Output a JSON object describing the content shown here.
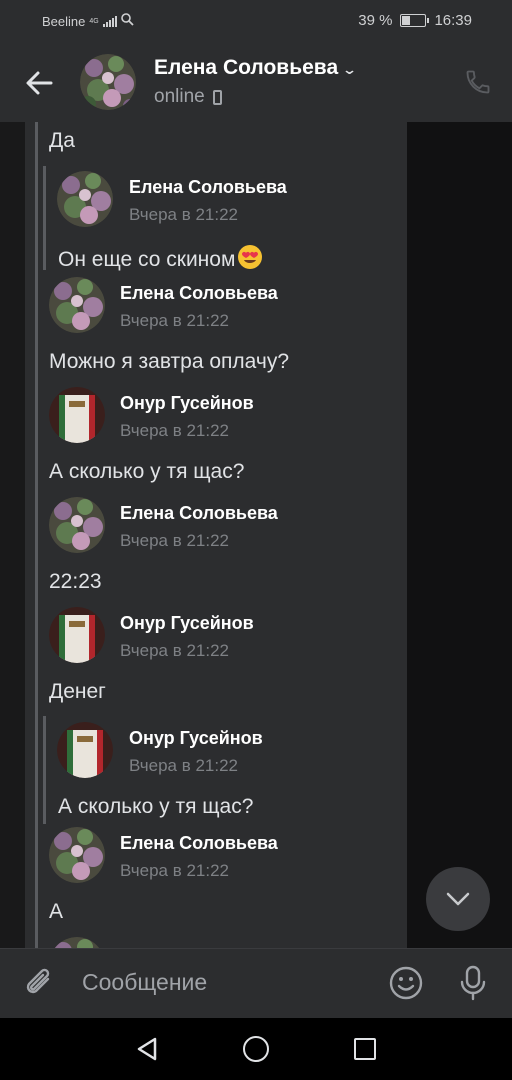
{
  "status_bar": {
    "carrier": "Beeline",
    "network": "4G",
    "battery": "39 %",
    "battery_level": 0.39,
    "time": "16:39"
  },
  "header": {
    "name": "Елена Соловьева",
    "status": "online",
    "icons": {
      "back": "arrow-left-icon",
      "expand": "chevron-down-icon",
      "device": "mobile-phone-icon",
      "call": "phone-call-icon"
    }
  },
  "messages": {
    "m1_text": "Да",
    "q1": {
      "author": "Елена Соловьева",
      "time": "Вчера в 21:22",
      "text": "Он еще со скином"
    },
    "m2": {
      "author": "Елена Соловьева",
      "time": "Вчера в 21:22",
      "text": "Можно я завтра оплачу?"
    },
    "m3": {
      "author": "Онур Гусейнов",
      "time": "Вчера в 21:22",
      "text": "А сколько у тя щас?"
    },
    "m4": {
      "author": "Елена Соловьева",
      "time": "Вчера в 21:22",
      "text": "22:23"
    },
    "m5": {
      "author": "Онур Гусейнов",
      "time": "Вчера в 21:22",
      "text": "Денег"
    },
    "q2": {
      "author": "Онур Гусейнов",
      "time": "Вчера в 21:22",
      "text": "А сколько у тя щас?"
    },
    "m6": {
      "author": "Елена Соловьева",
      "time": "Вчера в 21:22",
      "text": "А"
    }
  },
  "composer": {
    "placeholder": "Сообщение",
    "icons": {
      "attach": "paperclip-icon",
      "emoji": "smile-icon",
      "voice": "microphone-icon"
    }
  },
  "colors": {
    "background": "#19191a",
    "panel": "#2c2d2f",
    "text": "#e1e3e6",
    "muted": "#7e8185"
  }
}
